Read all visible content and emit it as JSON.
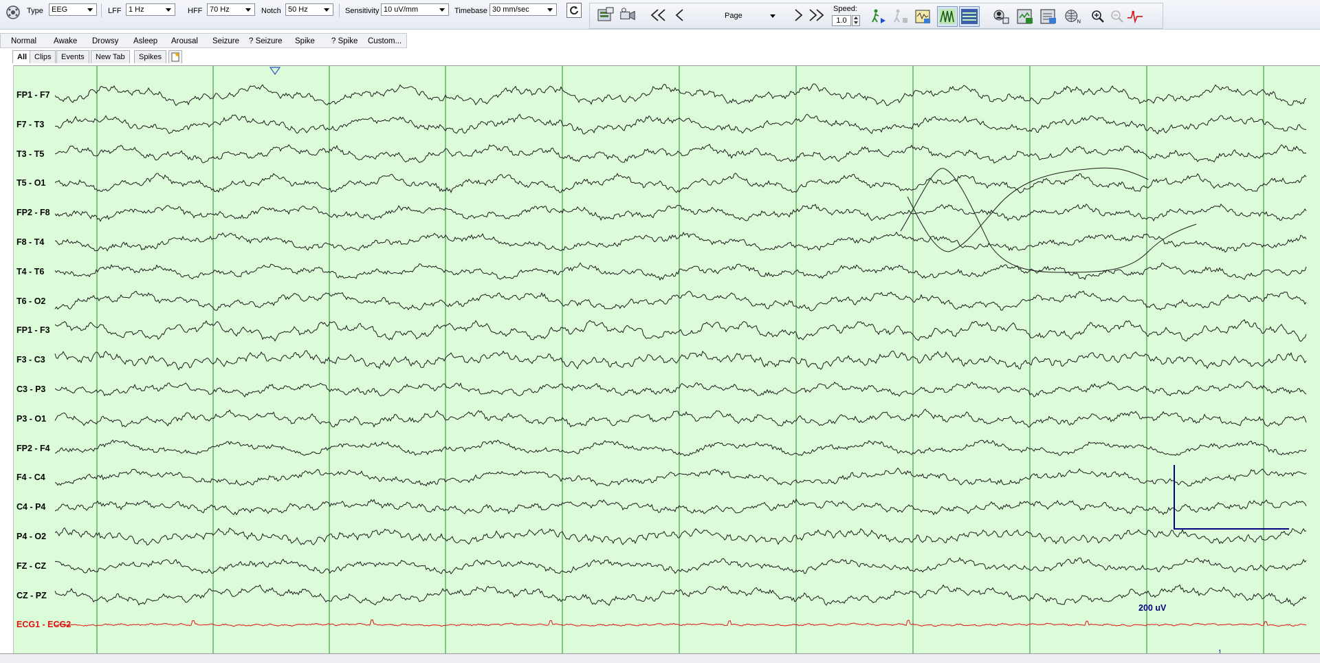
{
  "toolbar": {
    "type_label": "Type",
    "type_value": "EEG",
    "lff_label": "LFF",
    "lff_value": "1 Hz",
    "hff_label": "HFF",
    "hff_value": "70 Hz",
    "notch_label": "Notch",
    "notch_value": "50 Hz",
    "sensitivity_label": "Sensitivity",
    "sensitivity_value": "10 uV/mm",
    "timebase_label": "Timebase",
    "timebase_value": "30 mm/sec"
  },
  "navigation": {
    "page_label": "Page",
    "speed_label": "Speed:",
    "speed_value": "1.0"
  },
  "event_buttons": [
    "Normal",
    "Awake",
    "Drowsy",
    "Asleep",
    "Arousal",
    "Seizure",
    "? Seizure",
    "Spike",
    "? Spike",
    "Custom..."
  ],
  "tabs": [
    "All",
    "Clips",
    "Events",
    "New Tab",
    "Spikes"
  ],
  "channels": [
    "FP1 - F7",
    "F7 - T3",
    "T3 - T5",
    "T5 - O1",
    "FP2 - F8",
    "F8 - T4",
    "T4 - T6",
    "T6 - O2",
    "FP1 - F3",
    "F3 - C3",
    "C3 - P3",
    "P3 - O1",
    "FP2 - F4",
    "F4 - C4",
    "C4 - P4",
    "P4 - O2",
    "FZ - CZ",
    "CZ - PZ",
    "ECG1 - ECG2"
  ],
  "calibration": {
    "label": "200 uV",
    "time_label": "1"
  },
  "colors": {
    "background": "#dcfcd9",
    "trace": "#1a1a1a",
    "ecg": "#e01010",
    "second_line": "#2a8a2a",
    "calibration": "#000080"
  }
}
